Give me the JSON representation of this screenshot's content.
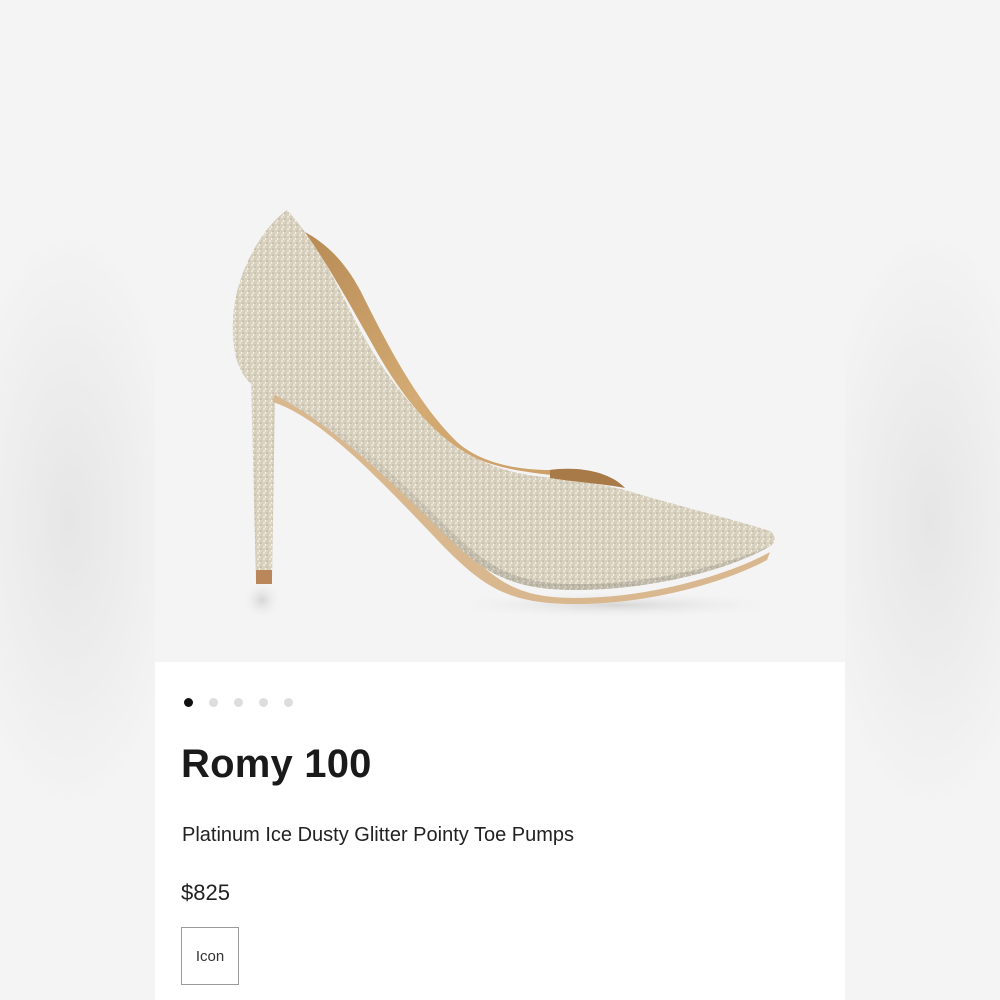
{
  "product": {
    "name": "Romy 100",
    "description": "Platinum Ice Dusty Glitter Pointy Toe Pumps",
    "price": "$825",
    "icon_option_label": "Icon"
  },
  "gallery": {
    "image_count": 5,
    "active_index": 0,
    "image_subject": "shoe-image"
  },
  "colors": {
    "active_dot": "#111111",
    "inactive_dot": "#dddddd",
    "glitter": "#d9d3c3",
    "lining": "#c9a06a"
  }
}
